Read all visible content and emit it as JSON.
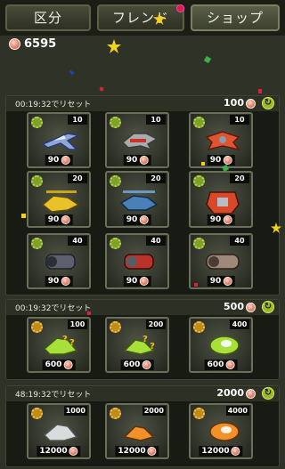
{
  "tabs": [
    {
      "label": "区分",
      "active": false
    },
    {
      "label": "フレンド",
      "active": false,
      "has_notification": true
    },
    {
      "label": "ショップ",
      "active": true
    }
  ],
  "balance": "6595",
  "sections": [
    {
      "reset_label": "00:19:32でリセット",
      "refresh_price": "100",
      "items": [
        {
          "icon": "fighter-jet-icon",
          "count": "10",
          "price": "90"
        },
        {
          "icon": "silver-jet-icon",
          "count": "10",
          "price": "90"
        },
        {
          "icon": "red-plane-icon",
          "count": "10",
          "price": "90"
        },
        {
          "icon": "yellow-helicopter-icon",
          "count": "20",
          "price": "90"
        },
        {
          "icon": "blue-helicopter-icon",
          "count": "20",
          "price": "90"
        },
        {
          "icon": "red-mech-icon",
          "count": "20",
          "price": "90"
        },
        {
          "icon": "grey-engine-icon",
          "count": "40",
          "price": "90"
        },
        {
          "icon": "red-engine-icon",
          "count": "40",
          "price": "90"
        },
        {
          "icon": "bronze-engine-icon",
          "count": "40",
          "price": "90"
        }
      ]
    },
    {
      "reset_label": "00:19:32でリセット",
      "refresh_price": "500",
      "items": [
        {
          "icon": "mystery-green-plane-icon",
          "count": "100",
          "price": "600"
        },
        {
          "icon": "mystery-green-jet-icon",
          "count": "200",
          "price": "600"
        },
        {
          "icon": "mystery-green-pod-icon",
          "count": "400",
          "price": "600"
        }
      ]
    },
    {
      "reset_label": "48:19:32でリセット",
      "refresh_price": "2000",
      "items": [
        {
          "icon": "silver-plane-icon",
          "count": "1000",
          "price": "12000"
        },
        {
          "icon": "orange-jet-icon",
          "count": "2000",
          "price": "12000"
        },
        {
          "icon": "orange-pod-icon",
          "count": "4000",
          "price": "12000"
        }
      ]
    }
  ],
  "colors": {
    "accent_green": "#9ab82a",
    "background": "#2f3226",
    "card_border": "#6a6f5a"
  }
}
